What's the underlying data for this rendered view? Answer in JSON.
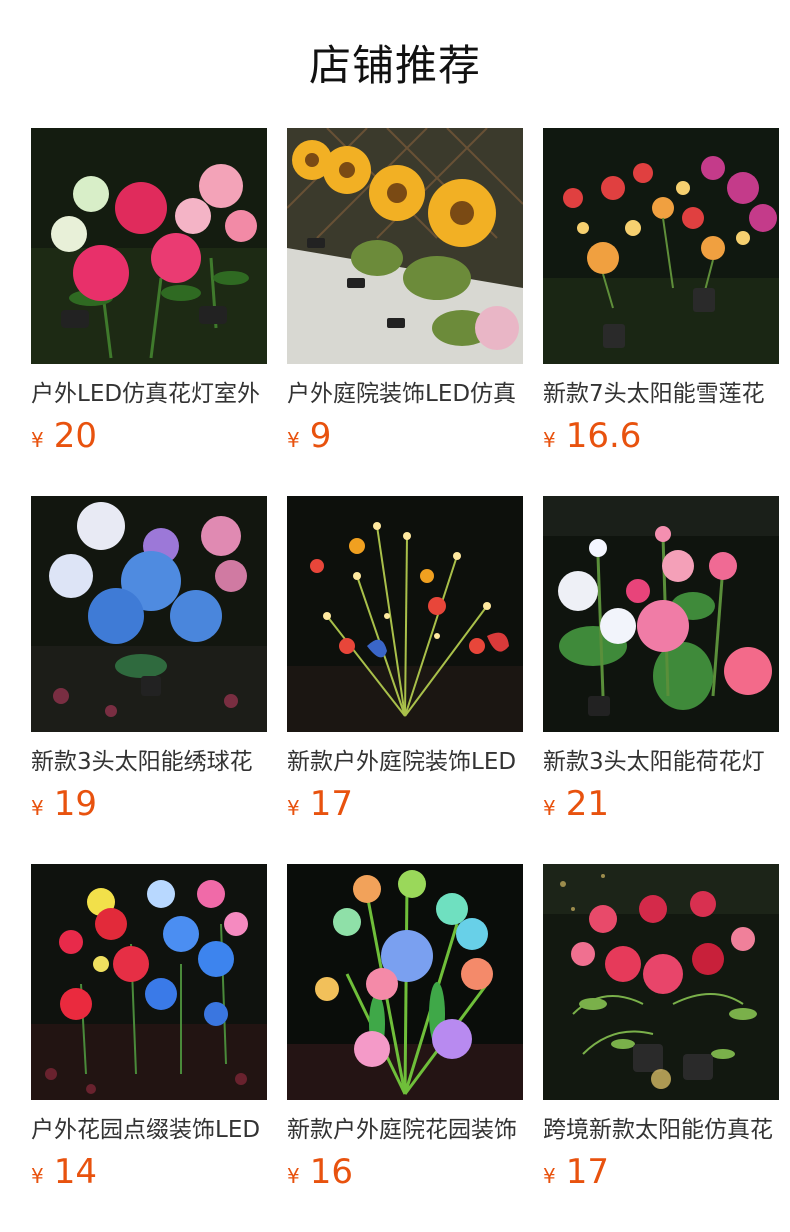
{
  "header": {
    "title": "店铺推荐"
  },
  "products": [
    {
      "name": "户外LED仿真花灯室外",
      "currency": "¥",
      "price": "20",
      "image_icon": "peony-solar-light-image"
    },
    {
      "name": "户外庭院装饰LED仿真",
      "currency": "¥",
      "price": "9",
      "image_icon": "sunflower-solar-light-image"
    },
    {
      "name": "新款7头太阳能雪莲花",
      "currency": "¥",
      "price": "16.6",
      "image_icon": "snow-lotus-solar-light-image"
    },
    {
      "name": "新款3头太阳能绣球花",
      "currency": "¥",
      "price": "19",
      "image_icon": "hydrangea-solar-light-image"
    },
    {
      "name": "新款户外庭院装饰LED",
      "currency": "¥",
      "price": "17",
      "image_icon": "butterfly-solar-light-image"
    },
    {
      "name": "新款3头太阳能荷花灯",
      "currency": "¥",
      "price": "21",
      "image_icon": "lotus-solar-light-image"
    },
    {
      "name": "户外花园点缀装饰LED",
      "currency": "¥",
      "price": "14",
      "image_icon": "rose-solar-light-image"
    },
    {
      "name": "新款户外庭院花园装饰",
      "currency": "¥",
      "price": "16",
      "image_icon": "lily-solar-light-image"
    },
    {
      "name": "跨境新款太阳能仿真花",
      "currency": "¥",
      "price": "17",
      "image_icon": "carnation-solar-light-image"
    }
  ],
  "colors": {
    "price": "#e8520e",
    "title": "#111111",
    "name": "#333333"
  }
}
